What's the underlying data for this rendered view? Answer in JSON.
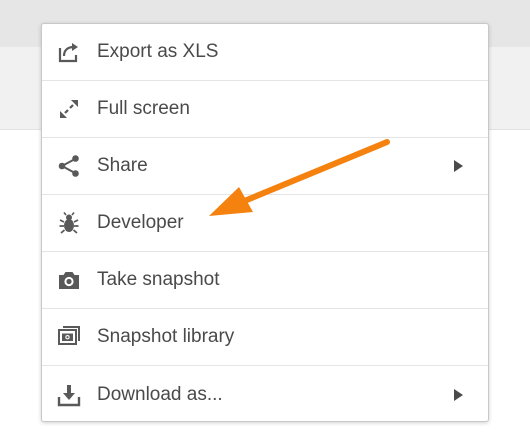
{
  "menu": {
    "items": [
      {
        "label": "Export as XLS",
        "icon": "export-icon",
        "has_submenu": false
      },
      {
        "label": "Full screen",
        "icon": "fullscreen-icon",
        "has_submenu": false
      },
      {
        "label": "Share",
        "icon": "share-icon",
        "has_submenu": true
      },
      {
        "label": "Developer",
        "icon": "bug-icon",
        "has_submenu": false
      },
      {
        "label": "Take snapshot",
        "icon": "camera-icon",
        "has_submenu": false
      },
      {
        "label": "Snapshot library",
        "icon": "snapshot-library-icon",
        "has_submenu": false
      },
      {
        "label": "Download as...",
        "icon": "download-icon",
        "has_submenu": true
      }
    ]
  },
  "annotation": {
    "type": "arrow",
    "color": "#f5820f",
    "points_to": "Developer"
  },
  "colors": {
    "text": "#4a4a4a",
    "icon": "#595959",
    "divider": "#e4e4e4",
    "background_band_top": "#e6e6e6",
    "background_band_mid": "#f1f1f1"
  }
}
